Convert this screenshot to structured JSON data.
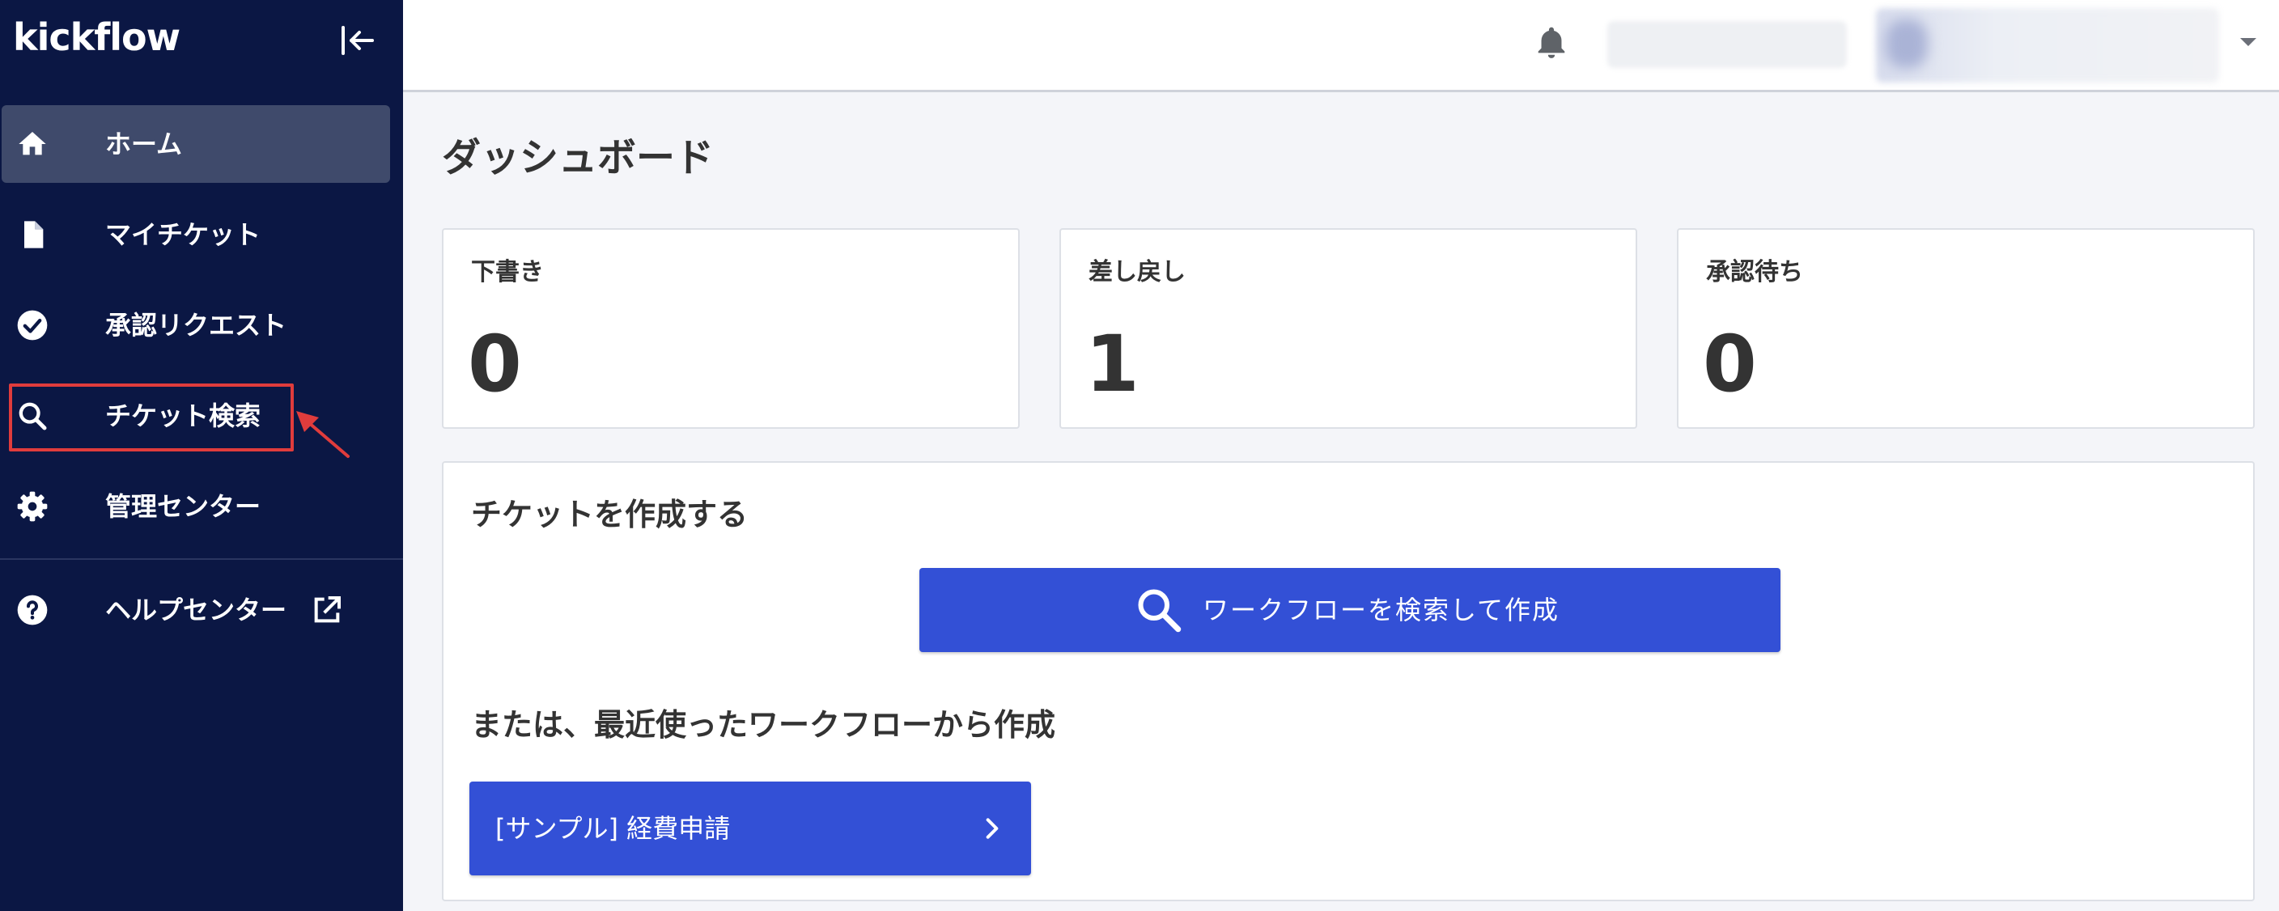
{
  "app": {
    "brand": "kickflow"
  },
  "sidebar": {
    "items": [
      {
        "label": "ホーム",
        "icon": "home-icon",
        "active": true
      },
      {
        "label": "マイチケット",
        "icon": "document-icon"
      },
      {
        "label": "承認リクエスト",
        "icon": "check-circle-icon"
      },
      {
        "label": "チケット検索",
        "icon": "search-icon",
        "highlighted": true
      },
      {
        "label": "管理センター",
        "icon": "gear-icon"
      },
      {
        "label": "ヘルプセンター",
        "icon": "help-circle-icon",
        "external": true
      }
    ]
  },
  "colors": {
    "sidebar_bg": "#0b1744",
    "sidebar_active": "#3f4a6b",
    "primary": "#3350d6",
    "annotation": "#e03c3c",
    "page_bg": "#f4f5f9"
  },
  "main": {
    "title": "ダッシュボード",
    "stats": [
      {
        "label": "下書き",
        "value": "0"
      },
      {
        "label": "差し戻し",
        "value": "1"
      },
      {
        "label": "承認待ち",
        "value": "0"
      }
    ],
    "create": {
      "heading": "チケットを作成する",
      "search_button": "ワークフローを検索して作成",
      "recent_heading": "または、最近使ったワークフローから作成",
      "recent_workflows": [
        {
          "label": "[サンプル] 経費申請"
        }
      ]
    }
  }
}
